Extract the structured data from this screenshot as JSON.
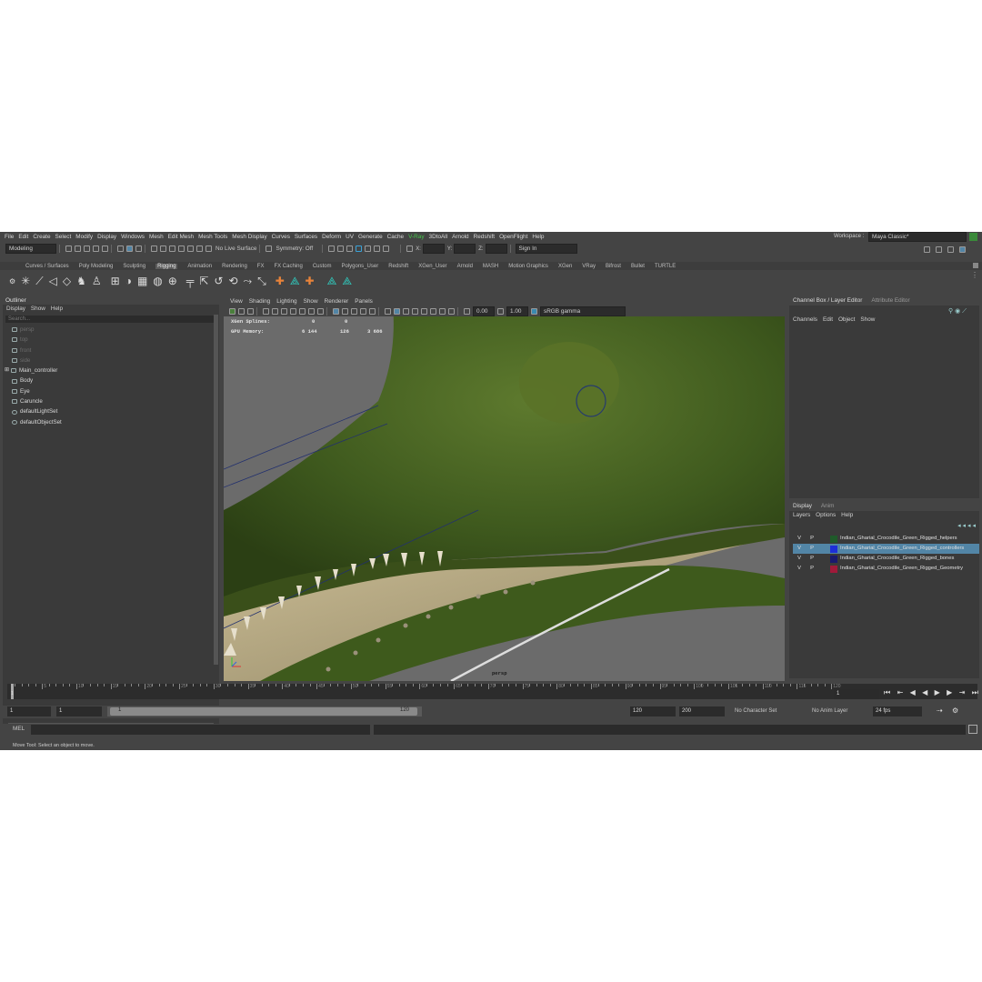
{
  "menubar": {
    "items": [
      "File",
      "Edit",
      "Create",
      "Select",
      "Modify",
      "Display",
      "Windows",
      "Mesh",
      "Edit Mesh",
      "Mesh Tools",
      "Mesh Display",
      "Curves",
      "Surfaces",
      "Deform",
      "UV",
      "Generate",
      "Cache",
      "V-Ray",
      "3DtoAll",
      "Arnold",
      "Redshift",
      "OpenFlight",
      "Help"
    ],
    "workspace_label": "Workspace :",
    "workspace_value": "Maya Classic*"
  },
  "toolbar": {
    "mode": "Modeling",
    "live_surface": "No Live Surface",
    "symmetry": "Symmetry: Off",
    "x_label": "X:",
    "y_label": "Y:",
    "z_label": "Z:",
    "sign_in": "Sign In"
  },
  "shelf": {
    "tabs": [
      "Curves / Surfaces",
      "Poly Modeling",
      "Sculpting",
      "Rigging",
      "Animation",
      "Rendering",
      "FX",
      "FX Caching",
      "Custom",
      "Polygons_User",
      "Redshift",
      "XGen_User",
      "Arnold",
      "MASH",
      "Motion Graphics",
      "XGen",
      "VRay",
      "Bifrost",
      "Bullet",
      "TURTLE"
    ],
    "active_tab": "Rigging"
  },
  "outliner": {
    "title": "Outliner",
    "menu": [
      "Display",
      "Show",
      "Help"
    ],
    "search_placeholder": "Search...",
    "items": [
      {
        "label": "persp",
        "dim": true,
        "icon": "camera-icon"
      },
      {
        "label": "top",
        "dim": true,
        "icon": "camera-icon"
      },
      {
        "label": "front",
        "dim": true,
        "icon": "camera-icon"
      },
      {
        "label": "side",
        "dim": true,
        "icon": "camera-icon"
      },
      {
        "label": "Main_controller",
        "dim": false,
        "icon": "transform-icon",
        "expandable": true
      },
      {
        "label": "Body",
        "dim": false,
        "icon": "transform-icon"
      },
      {
        "label": "Eye",
        "dim": false,
        "icon": "transform-icon"
      },
      {
        "label": "Caruncle",
        "dim": false,
        "icon": "transform-icon"
      },
      {
        "label": "defaultLightSet",
        "dim": false,
        "icon": "set-icon"
      },
      {
        "label": "defaultObjectSet",
        "dim": false,
        "icon": "set-icon"
      }
    ]
  },
  "viewport": {
    "menu": [
      "View",
      "Shading",
      "Lighting",
      "Show",
      "Renderer",
      "Panels"
    ],
    "exposure": "0.00",
    "gamma": "1.00",
    "color_space": "sRGB gamma",
    "hud": {
      "xgen_label": "XGen Splines:",
      "xgen_values": [
        "0",
        "0"
      ],
      "gpu_label": "GPU Memory:",
      "gpu_values": [
        "6 144",
        "126",
        "3 686"
      ]
    },
    "camera_label": "persp"
  },
  "channel_box": {
    "tabs": [
      "Channel Box / Layer Editor",
      "Attribute Editor"
    ],
    "menu": [
      "Channels",
      "Edit",
      "Object",
      "Show"
    ]
  },
  "layer_editor": {
    "tabs": [
      "Display",
      "Anim"
    ],
    "menu": [
      "Layers",
      "Options",
      "Help"
    ],
    "layers": [
      {
        "v": "V",
        "p": "P",
        "name": "Indian_Gharial_Crocodile_Green_Rigged_helpers",
        "color": "#1f5a2a",
        "selected": false
      },
      {
        "v": "V",
        "p": "P",
        "name": "Indian_Gharial_Crocodile_Green_Rigged_controllers",
        "color": "#1d2fd8",
        "selected": true
      },
      {
        "v": "V",
        "p": "P",
        "name": "Indian_Gharial_Crocodile_Green_Rigged_bones",
        "color": "#1a1a6e",
        "selected": false
      },
      {
        "v": "V",
        "p": "P",
        "name": "Indian_Gharial_Crocodile_Green_Rigged_Geometry",
        "color": "#a01a3a",
        "selected": false
      }
    ]
  },
  "timeline": {
    "ticks": [
      "5",
      "10",
      "15",
      "20",
      "25",
      "30",
      "35",
      "40",
      "45",
      "50",
      "55",
      "60",
      "65",
      "70",
      "75",
      "80",
      "85",
      "90",
      "95",
      "100",
      "105",
      "110",
      "115",
      "120"
    ],
    "current_frame": "1",
    "current_field": "1"
  },
  "range": {
    "start": "1",
    "playback_start": "1",
    "slider_start": "1",
    "slider_end": "120",
    "playback_end": "120",
    "end": "200",
    "character_set": "No Character Set",
    "anim_layer": "No Anim Layer",
    "fps": "24 fps"
  },
  "command": {
    "mel_label": "MEL"
  },
  "status": {
    "help_line": "Move Tool: Select an object to move."
  },
  "colors": {
    "selection": "#5285a6",
    "vray": "#47c74c",
    "teal": "#2fd1c4"
  }
}
